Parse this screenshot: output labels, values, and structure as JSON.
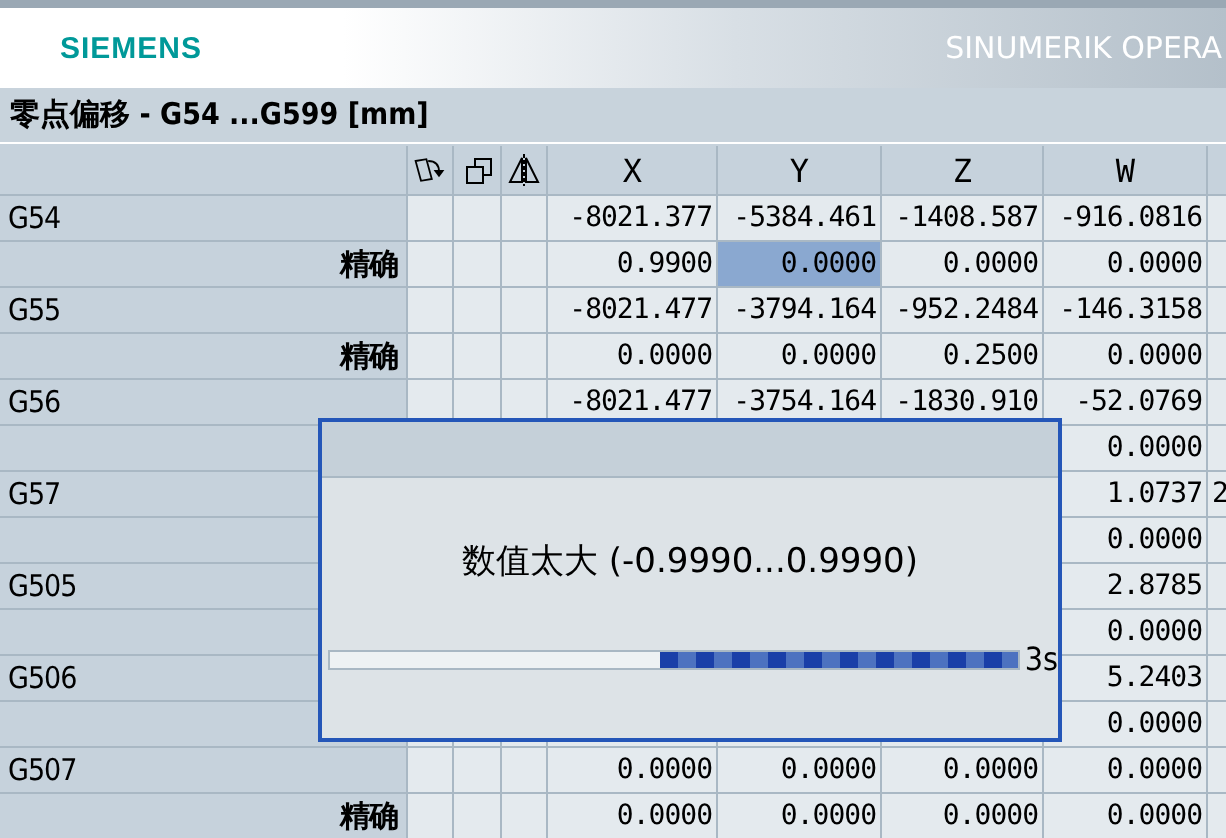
{
  "header": {
    "logo": "SIEMENS",
    "product": "SINUMERIK OPERA"
  },
  "title": "零点偏移 - G54 ...G599 [mm]",
  "table": {
    "columns": [
      "X",
      "Y",
      "Z",
      "W"
    ],
    "rows": [
      {
        "kind": "offset",
        "label": "G54",
        "cells": [
          {
            "text": "-8021.377",
            "selected": false
          },
          {
            "text": "-5384.461",
            "selected": false
          },
          {
            "text": "-1408.587",
            "selected": false
          },
          {
            "text": "-916.0816",
            "selected": false
          }
        ]
      },
      {
        "kind": "fine",
        "label": "精确",
        "cells": [
          {
            "text": "0.9900",
            "selected": false
          },
          {
            "text": "0.0000",
            "selected": true
          },
          {
            "text": "0.0000",
            "selected": false
          },
          {
            "text": "0.0000",
            "selected": false
          }
        ]
      },
      {
        "kind": "offset",
        "label": "G55",
        "cells": [
          {
            "text": "-8021.477",
            "selected": false
          },
          {
            "text": "-3794.164",
            "selected": false
          },
          {
            "text": "-952.2484",
            "selected": false
          },
          {
            "text": "-146.3158",
            "selected": false
          }
        ]
      },
      {
        "kind": "fine",
        "label": "精确",
        "cells": [
          {
            "text": "0.0000",
            "selected": false
          },
          {
            "text": "0.0000",
            "selected": false
          },
          {
            "text": "0.2500",
            "selected": false
          },
          {
            "text": "0.0000",
            "selected": false
          }
        ]
      },
      {
        "kind": "offset",
        "label": "G56",
        "cells": [
          {
            "text": "-8021.477",
            "selected": false
          },
          {
            "text": "-3754.164",
            "selected": false
          },
          {
            "text": "-1830.910",
            "selected": false
          },
          {
            "text": "-52.0769",
            "selected": false
          }
        ]
      },
      {
        "kind": "fine",
        "cells": [
          null,
          null,
          null,
          {
            "text": "0.0000",
            "selected": false
          }
        ]
      },
      {
        "kind": "offset",
        "label": "G57",
        "cells": [
          null,
          null,
          null,
          {
            "text": "1.0737",
            "selected": false
          }
        ],
        "extra": "2"
      },
      {
        "kind": "fine",
        "cells": [
          null,
          null,
          null,
          {
            "text": "0.0000",
            "selected": false
          }
        ]
      },
      {
        "kind": "offset",
        "label": "G505",
        "cells": [
          null,
          null,
          null,
          {
            "text": "2.8785",
            "selected": false
          }
        ]
      },
      {
        "kind": "fine",
        "cells": [
          null,
          null,
          null,
          {
            "text": "0.0000",
            "selected": false
          }
        ]
      },
      {
        "kind": "offset",
        "label": "G506",
        "cells": [
          null,
          null,
          null,
          {
            "text": "5.2403",
            "selected": false
          }
        ]
      },
      {
        "kind": "fine",
        "cells": [
          null,
          null,
          null,
          {
            "text": "0.0000",
            "selected": false
          }
        ]
      },
      {
        "kind": "offset",
        "label": "G507",
        "cells": [
          {
            "text": "0.0000",
            "selected": false
          },
          {
            "text": "0.0000",
            "selected": false
          },
          {
            "text": "0.0000",
            "selected": false
          },
          {
            "text": "0.0000",
            "selected": false
          }
        ]
      },
      {
        "kind": "fine",
        "label": "精确",
        "cells": [
          {
            "text": "0.0000",
            "selected": false
          },
          {
            "text": "0.0000",
            "selected": false
          },
          {
            "text": "0.0000",
            "selected": false
          },
          {
            "text": "0.0000",
            "selected": false
          }
        ]
      }
    ]
  },
  "dialog": {
    "message": "数值太大 (-0.9990...0.9990)",
    "progress": {
      "level": 0.52
    },
    "countdown": "3s"
  }
}
